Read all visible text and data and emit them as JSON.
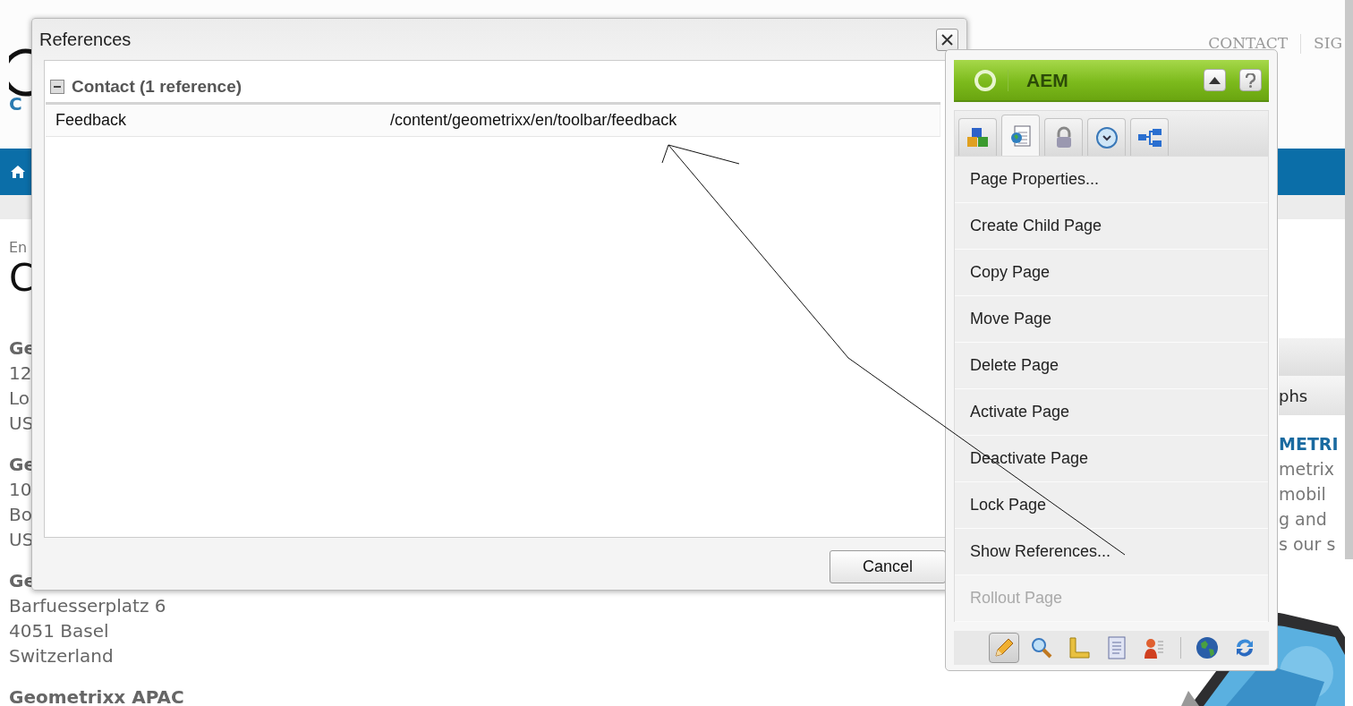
{
  "background_page": {
    "header_links": [
      "CONTACT",
      "SIG"
    ],
    "logo_fragment": "C",
    "breadcrumb_fragment": "En",
    "heading_fragment": "C",
    "addresses": [
      {
        "name": "Ge",
        "lines": [
          "12",
          "Lo",
          "US"
        ]
      },
      {
        "name": "Ge",
        "lines": [
          "10",
          "Bo",
          "US"
        ]
      },
      {
        "name": "Ge",
        "lines": [
          "Barfuesserplatz 6",
          "4051 Basel",
          "Switzerland"
        ]
      },
      {
        "name": "Geometrixx APAC"
      }
    ],
    "side_tab_fragment": "phs",
    "promo_title_fragment": "METRI",
    "promo_lines": [
      "metrix",
      "mobil",
      "g and",
      "s our s"
    ],
    "promo_image": {
      "kind": "picture"
    }
  },
  "references_dialog": {
    "title": "References",
    "groups": [
      {
        "label": "Contact (1 reference)",
        "expanded": true,
        "rows": [
          {
            "title": "Feedback",
            "path": "/content/geometrixx/en/toolbar/feedback"
          }
        ]
      }
    ],
    "buttons": [
      "Cancel"
    ]
  },
  "sidekick": {
    "title": "AEM",
    "tabs": [
      {
        "kind": "components",
        "selected": false
      },
      {
        "kind": "page",
        "selected": true
      },
      {
        "kind": "lock",
        "selected": false
      },
      {
        "kind": "clock",
        "selected": false
      },
      {
        "kind": "tree",
        "selected": false
      }
    ],
    "menu": [
      {
        "label": "Page Properties...",
        "disabled": false
      },
      {
        "label": "Create Child Page",
        "disabled": false
      },
      {
        "label": "Copy Page",
        "disabled": false
      },
      {
        "label": "Move Page",
        "disabled": false
      },
      {
        "label": "Delete Page",
        "disabled": false
      },
      {
        "label": "Activate Page",
        "disabled": false
      },
      {
        "label": "Deactivate Page",
        "disabled": false
      },
      {
        "label": "Lock Page",
        "disabled": false
      },
      {
        "label": "Show References...",
        "disabled": false
      },
      {
        "label": "Rollout Page",
        "disabled": true
      }
    ],
    "toolbar": [
      {
        "kind": "edit",
        "selected": true
      },
      {
        "kind": "preview",
        "selected": false
      },
      {
        "kind": "design",
        "selected": false
      },
      {
        "kind": "document",
        "selected": false
      },
      {
        "kind": "user",
        "selected": false
      },
      {
        "kind": "separator"
      },
      {
        "kind": "globe",
        "selected": false
      },
      {
        "kind": "refresh",
        "selected": false
      }
    ]
  }
}
